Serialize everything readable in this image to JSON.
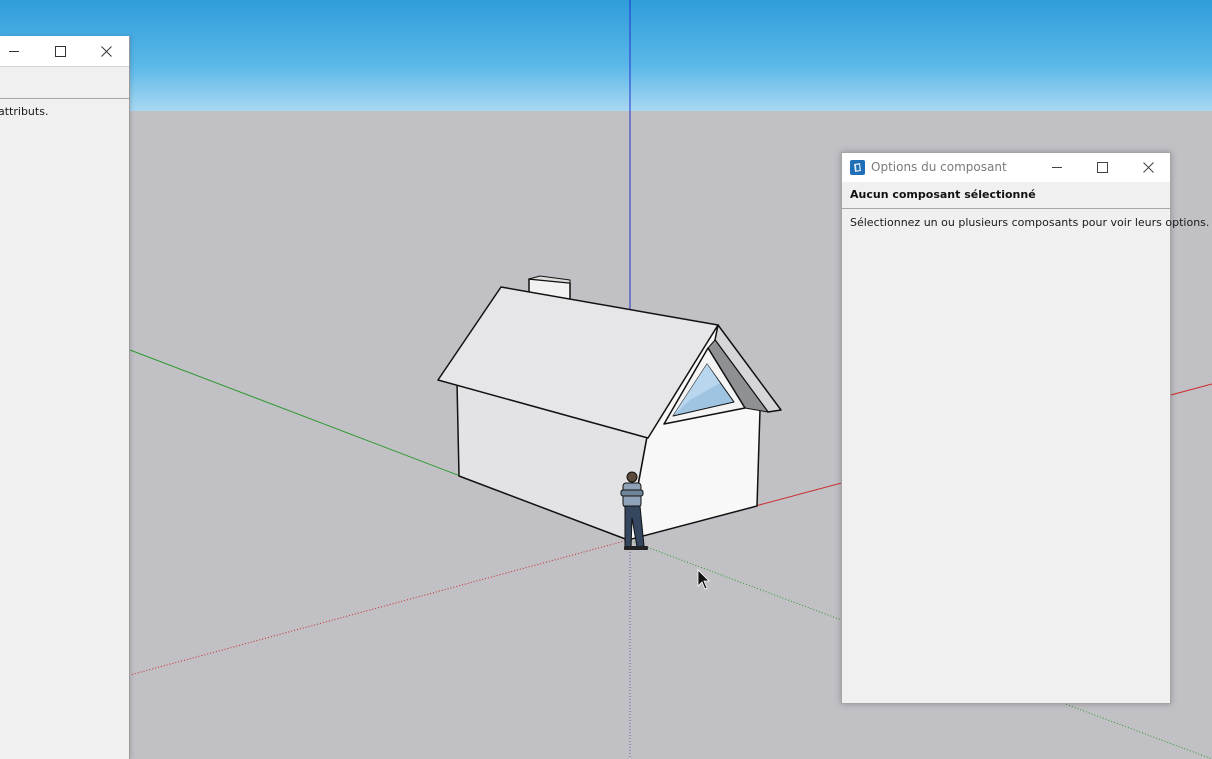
{
  "left_panel": {
    "content_text": "attributs."
  },
  "component_options": {
    "title": "Options du composant",
    "header": "Aucun composant sélectionné",
    "message": "Sélectionnez un ou plusieurs composants pour voir leurs options."
  },
  "colors": {
    "sky": "#3aa6df",
    "ground": "#c1c0c5",
    "axis_red": "#cc2a2a",
    "axis_green": "#2e9a2e",
    "axis_blue": "#2233cc",
    "panel_bg": "#f0f0f0"
  },
  "icons": [
    "minimize-icon",
    "maximize-icon",
    "close-icon",
    "sketchup-app-icon",
    "mouse-pointer-icon"
  ]
}
